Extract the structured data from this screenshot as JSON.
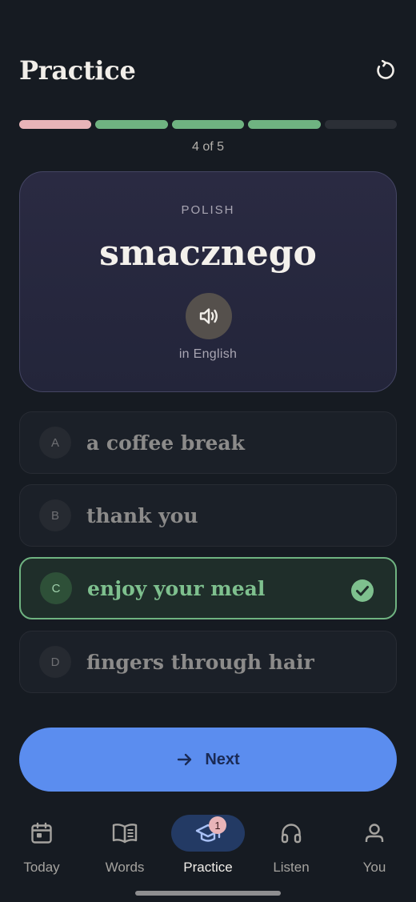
{
  "header": {
    "title": "Practice",
    "restart_icon": "restart-icon"
  },
  "progress": {
    "segments": [
      "wrong",
      "right",
      "right",
      "right",
      "pending"
    ],
    "counter": "4 of 5"
  },
  "card": {
    "language": "POLISH",
    "word": "smacznego",
    "audio_icon": "speaker-icon",
    "subtitle": "in English"
  },
  "options": [
    {
      "letter": "A",
      "text": "a coffee break",
      "state": "neutral"
    },
    {
      "letter": "B",
      "text": "thank you",
      "state": "neutral"
    },
    {
      "letter": "C",
      "text": "enjoy your meal",
      "state": "correct"
    },
    {
      "letter": "D",
      "text": "fingers through hair",
      "state": "neutral"
    }
  ],
  "next_button": {
    "label": "Next",
    "icon": "arrow-right-icon"
  },
  "nav": {
    "items": [
      {
        "label": "Today",
        "icon": "calendar-icon"
      },
      {
        "label": "Words",
        "icon": "book-icon"
      },
      {
        "label": "Practice",
        "icon": "graduation-cap-icon",
        "badge": "1",
        "active": true
      },
      {
        "label": "Listen",
        "icon": "headphones-icon"
      },
      {
        "label": "You",
        "icon": "person-icon"
      }
    ]
  },
  "colors": {
    "background": "#161b22",
    "accent": "#5b8def",
    "correct": "#6fb381",
    "wrong": "#e8b4b8"
  }
}
